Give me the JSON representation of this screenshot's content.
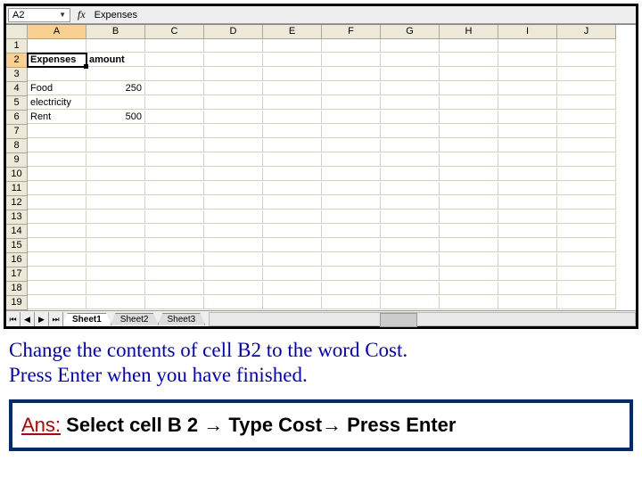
{
  "formula_bar": {
    "namebox": "A2",
    "fx_label": "fx",
    "value": "Expenses"
  },
  "columns": [
    "A",
    "B",
    "C",
    "D",
    "E",
    "F",
    "G",
    "H",
    "I",
    "J"
  ],
  "rows": [
    "1",
    "2",
    "3",
    "4",
    "5",
    "6",
    "7",
    "8",
    "9",
    "10",
    "11",
    "12",
    "13",
    "14",
    "15",
    "16",
    "17",
    "18",
    "19"
  ],
  "cells": {
    "A2": "Expenses",
    "B2": "amount",
    "A4": "Food",
    "B4": "250",
    "A5": "electricity",
    "A6": "Rent",
    "B6": "500"
  },
  "sheet_tabs": {
    "nav": [
      "⏮",
      "◀",
      "▶",
      "⏭"
    ],
    "tabs": [
      "Sheet1",
      "Sheet2",
      "Sheet3"
    ]
  },
  "instruction": {
    "line1": "Change the contents of cell B2 to the word Cost.",
    "line2": "Press Enter when you have finished."
  },
  "answer": {
    "label": "Ans:",
    "text": " Select cell B 2 → Type Cost→ Press Enter"
  }
}
